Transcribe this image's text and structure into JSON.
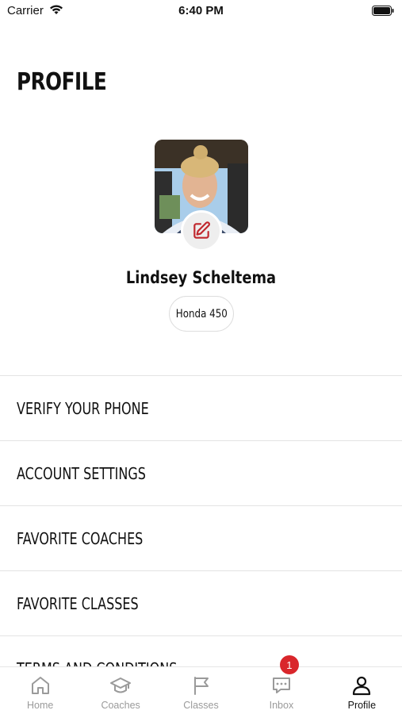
{
  "status_bar": {
    "carrier": "Carrier",
    "time": "6:40 PM"
  },
  "page": {
    "title": "PROFILE"
  },
  "profile": {
    "name": "Lindsey Scheltema",
    "bike": "Honda 450"
  },
  "menu": [
    {
      "label": "VERIFY YOUR PHONE"
    },
    {
      "label": "ACCOUNT SETTINGS"
    },
    {
      "label": "FAVORITE COACHES"
    },
    {
      "label": "FAVORITE CLASSES"
    },
    {
      "label": "TERMS AND CONDITIONS"
    }
  ],
  "tabs": [
    {
      "label": "Home",
      "icon": "home-icon"
    },
    {
      "label": "Coaches",
      "icon": "graduation-cap-icon"
    },
    {
      "label": "Classes",
      "icon": "flag-icon"
    },
    {
      "label": "Inbox",
      "icon": "chat-icon",
      "badge": "1"
    },
    {
      "label": "Profile",
      "icon": "user-icon",
      "active": true
    }
  ],
  "colors": {
    "accent": "#d9262b",
    "inactive_tab": "#9a9a9a",
    "text": "#111111"
  }
}
